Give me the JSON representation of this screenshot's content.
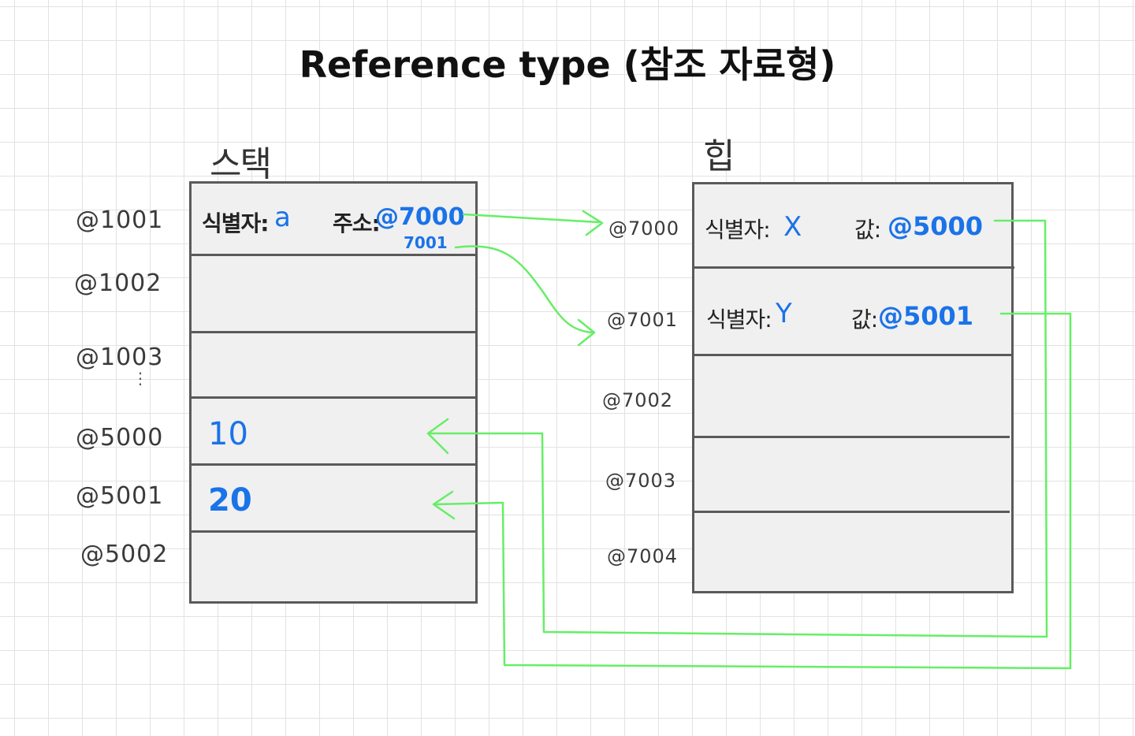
{
  "title": "Reference type (참조 자료형)",
  "colors": {
    "arrow": "#66ee66",
    "value": "#1a73e8",
    "box_fill": "#f0f0f0",
    "box_border": "#5a5a5a"
  },
  "stack": {
    "label": "스택",
    "addresses": [
      "@1001",
      "@1002",
      "@1003",
      "⋮",
      "@5000",
      "@5001",
      "@5002"
    ],
    "row1": {
      "identifier_label": "식별자:",
      "identifier_value": "a",
      "address_label": "주소:",
      "address_value": "@7000",
      "address_value_2": "7001"
    },
    "values": [
      "10",
      "20"
    ]
  },
  "heap": {
    "label": "힙",
    "addresses": [
      "@7000",
      "@7001",
      "@7002",
      "@7003",
      "@7004"
    ],
    "objects": [
      {
        "identifier_label": "식별자:",
        "identifier_value": "X",
        "value_label": "값:",
        "value": "@5000"
      },
      {
        "identifier_label": "식별자:",
        "identifier_value": "Y",
        "value_label": "값:",
        "value": "@5001"
      }
    ]
  }
}
